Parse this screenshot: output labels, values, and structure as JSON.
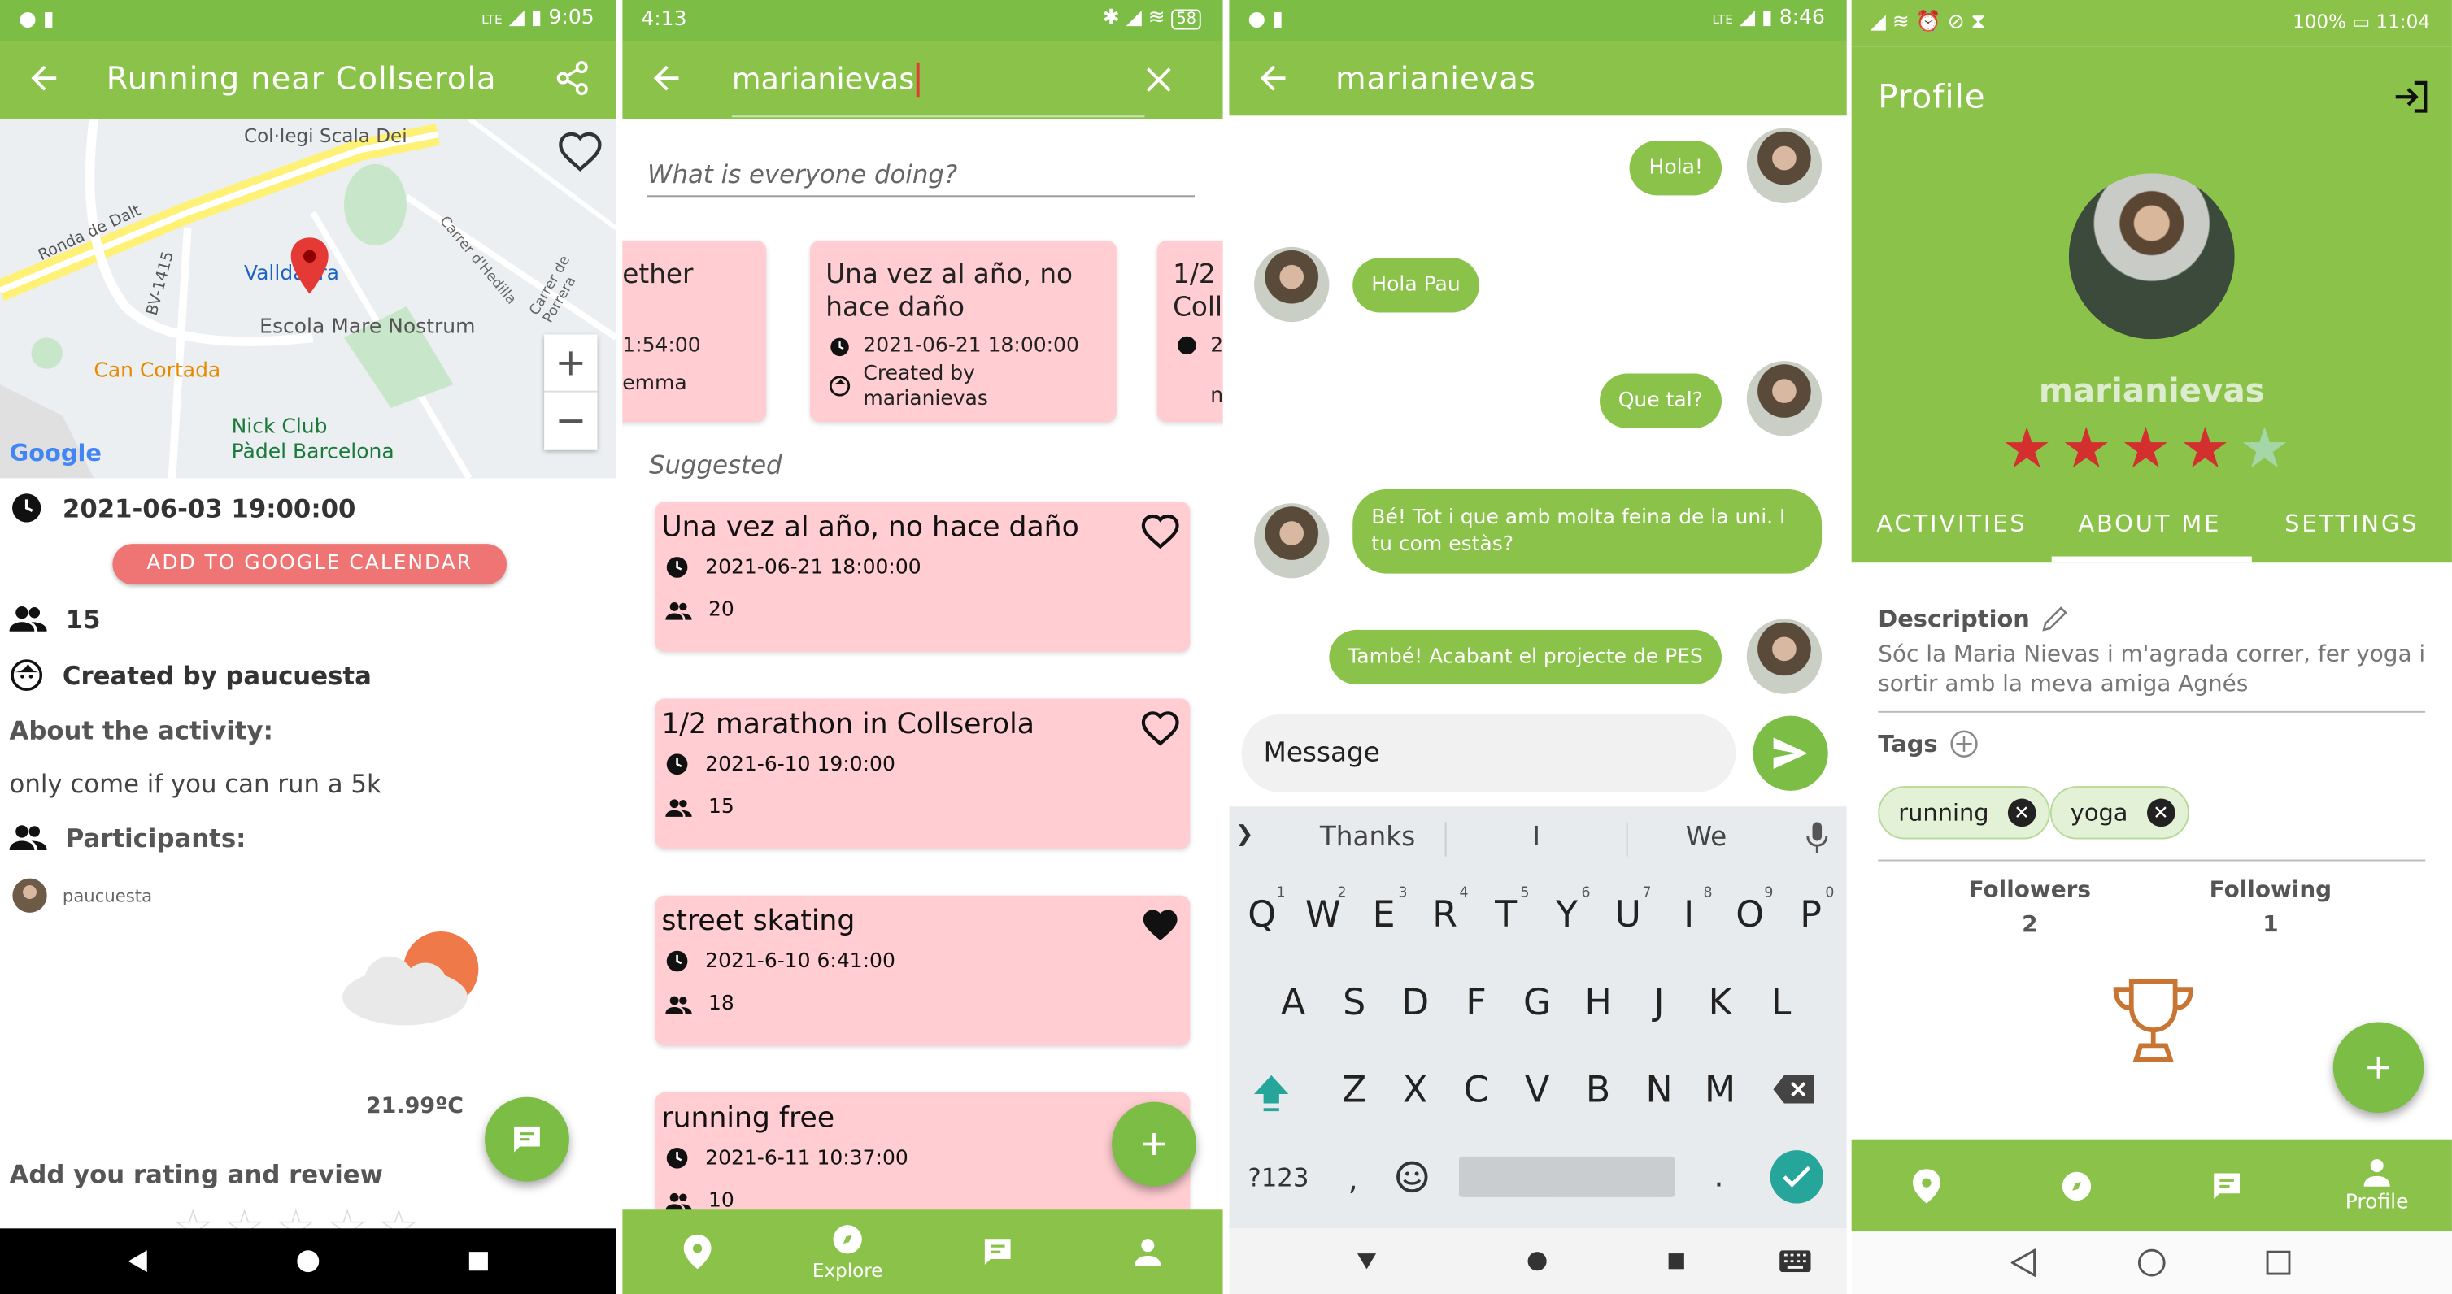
{
  "colors": {
    "primary": "#8bc34a",
    "status": "#7cbd45",
    "card": "#ffcdd2",
    "star_active": "#d32f2f",
    "star_inactive": "#a5d6a7",
    "trophy": "#c87533"
  },
  "screen1": {
    "status": {
      "time": "9:05",
      "signal": "LTE"
    },
    "title": "Running near Collserola",
    "map": {
      "labels": [
        "Col·legi Scala Dei",
        "Ronda de Dalt",
        "BV-1415",
        "Valldaura",
        "Carrer d'Hedilla",
        "Carrer de Porrera",
        "Escola Mare Nostrum",
        "Can Cortada",
        "Nick Club",
        "Pàdel Barcelona",
        "Google"
      ],
      "zoom_in": "+",
      "zoom_out": "−"
    },
    "datetime": "2021-06-03 19:00:00",
    "calendar_button": "ADD TO GOOGLE CALENDAR",
    "participants_count": "15",
    "created_by": "Created by paucuesta",
    "about_heading": "About the activity:",
    "about_text": "only come if you can run a 5k",
    "participants_heading": "Participants:",
    "participant": "paucuesta",
    "temperature": "21.99ºC",
    "rating_heading": "Add you rating and review"
  },
  "screen2": {
    "status": {
      "time": "4:13",
      "battery": "58"
    },
    "search_value": "marianievas",
    "composer_placeholder": "What is everyone doing?",
    "carousel": [
      {
        "title": "ether",
        "time": "1:54:00",
        "creator": "emma"
      },
      {
        "title": "Una vez al año, no hace daño",
        "time": "2021-06-21 18:00:00",
        "creator": "Created by marianievas"
      },
      {
        "title": "1/2 Coll",
        "time": "2",
        "creator": "n"
      }
    ],
    "suggested_heading": "Suggested",
    "list": [
      {
        "title": "Una vez al año, no hace daño",
        "time": "2021-06-21 18:00:00",
        "count": "20",
        "liked": false
      },
      {
        "title": "1/2 marathon in Collserola",
        "time": "2021-6-10 19:0:00",
        "count": "15",
        "liked": false
      },
      {
        "title": "street skating",
        "time": "2021-6-10 6:41:00",
        "count": "18",
        "liked": true
      },
      {
        "title": "running free",
        "time": "2021-6-11 10:37:00",
        "count": "10",
        "liked": false
      }
    ],
    "nav": {
      "explore": "Explore"
    }
  },
  "screen3": {
    "status": {
      "time": "8:46",
      "signal": "LTE"
    },
    "title": "marianievas",
    "messages": [
      {
        "text": "Hola!",
        "mine": true
      },
      {
        "text": "Hola Pau",
        "mine": false
      },
      {
        "text": "Que tal?",
        "mine": true
      },
      {
        "text": "Bé! Tot i que amb molta feina de la uni. I tu com estàs?",
        "mine": false
      },
      {
        "text": "També! Acabant el projecte de PES",
        "mine": true
      }
    ],
    "input_placeholder": "Message",
    "suggestions": [
      "Thanks",
      "I",
      "We"
    ],
    "keyboard": {
      "row1": [
        "Q",
        "W",
        "E",
        "R",
        "T",
        "Y",
        "U",
        "I",
        "O",
        "P"
      ],
      "row1_nums": [
        "1",
        "2",
        "3",
        "4",
        "5",
        "6",
        "7",
        "8",
        "9",
        "0"
      ],
      "row2": [
        "A",
        "S",
        "D",
        "F",
        "G",
        "H",
        "J",
        "K",
        "L"
      ],
      "row3": [
        "Z",
        "X",
        "C",
        "V",
        "B",
        "N",
        "M"
      ],
      "symbols": "?123",
      "comma": ",",
      "period": "."
    }
  },
  "screen4": {
    "status": {
      "battery": "100%",
      "time": "11:04"
    },
    "title": "Profile",
    "username": "marianievas",
    "rating": 4,
    "tabs": [
      "ACTIVITIES",
      "ABOUT ME",
      "SETTINGS"
    ],
    "description_label": "Description",
    "description": "Sóc la Maria Nievas i m'agrada correr, fer yoga i sortir amb la meva amiga Agnés",
    "tags_label": "Tags",
    "tags": [
      "running",
      "yoga"
    ],
    "followers_label": "Followers",
    "followers": "2",
    "following_label": "Following",
    "following": "1",
    "nav": {
      "profile": "Profile"
    }
  }
}
